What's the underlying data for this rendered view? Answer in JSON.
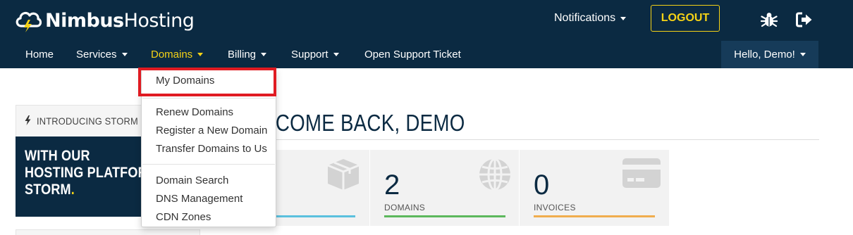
{
  "header": {
    "brand_bold": "Nimbus",
    "brand_light": "Hosting",
    "notifications_label": "Notifications",
    "logout_label": "LOGOUT",
    "icons": [
      "cloud-bolt-icon",
      "bug-icon",
      "sign-out-icon"
    ]
  },
  "nav": {
    "items": [
      {
        "label": "Home"
      },
      {
        "label": "Services"
      },
      {
        "label": "Domains"
      },
      {
        "label": "Billing"
      },
      {
        "label": "Support"
      },
      {
        "label": "Open Support Ticket"
      }
    ],
    "user_label": "Hello, Demo!"
  },
  "domains_menu": {
    "groups": [
      [
        "My Domains"
      ],
      [
        "Renew Domains",
        "Register a New Domain",
        "Transfer Domains to Us"
      ],
      [
        "Domain Search",
        "DNS Management",
        "CDN Zones"
      ]
    ]
  },
  "sidebar": {
    "promo_header": "INTRODUCING STORM",
    "promo_lines": [
      "WITH OUR",
      "HOSTING PLATFORM",
      "STORM"
    ],
    "promo_dot": "."
  },
  "main": {
    "welcome": "WELCOME BACK, DEMO",
    "stats": [
      {
        "value": "",
        "label": "",
        "icon": "box-icon",
        "color": "#5bc0de"
      },
      {
        "value": "2",
        "label": "DOMAINS",
        "icon": "globe-icon",
        "color": "#5cb85c"
      },
      {
        "value": "0",
        "label": "INVOICES",
        "icon": "credit-card-icon",
        "color": "#f0ad4e"
      }
    ]
  },
  "colors": {
    "header_bg": "#0b2a42",
    "accent_yellow": "#f5d216",
    "highlight_red": "#e01b22"
  }
}
